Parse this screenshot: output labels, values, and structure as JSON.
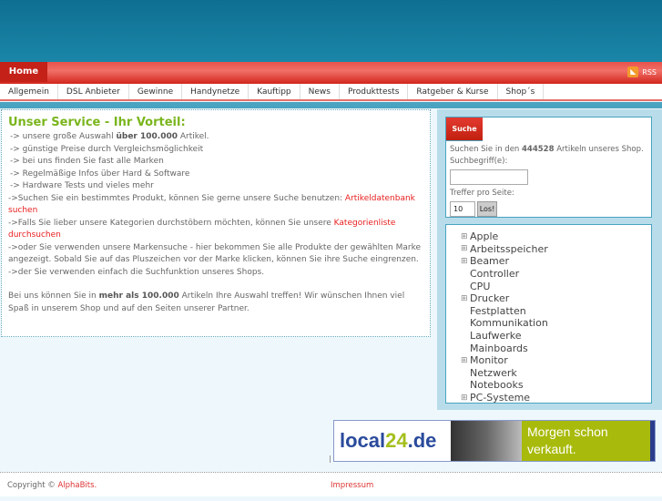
{
  "topbar": {
    "home": "Home",
    "rss": "RSS"
  },
  "nav": [
    "Allgemein",
    "DSL Anbieter",
    "Gewinne",
    "Handynetze",
    "Kauftipp",
    "News",
    "Produkttests",
    "Ratgeber & Kurse",
    "Shop´s"
  ],
  "main": {
    "title": "Unser Service - Ihr Vorteil:",
    "l1a": "-> unsere große Auswahl ",
    "l1b": "über 100.000",
    "l1c": " Artikel.",
    "l2": "-> günstige Preise durch Vergleichsmöglichkeit",
    "l3": "-> bei uns finden Sie fast alle Marken",
    "l4": "-> Regelmäßige Infos über Hard & Software",
    "l5": "-> Hardware Tests und vieles mehr",
    "p1a": "->Suchen Sie ein bestimmtes Produkt, können Sie gerne unsere Suche benutzen: ",
    "p1link": "Artikeldatenbank suchen",
    "p2a": "->Falls Sie lieber unsere Kategorien durchstöbern möchten, können Sie unsere ",
    "p2link": "Kategorienliste durchsuchen",
    "p3": "->oder Sie verwenden unsere Markensuche - hier bekommen Sie alle Produkte der gewählten Marke angezeigt. Sobald Sie auf das Pluszeichen vor der Marke klicken, können Sie ihre Suche eingrenzen.",
    "p4": "->der Sie verwenden einfach die Suchfunktion unseres Shops.",
    "p5a": "Bei uns können Sie in ",
    "p5b": "mehr als 100.000",
    "p5c": " Artikeln Ihre Auswahl treffen! Wir wünschen Ihnen viel Spaß in unserem Shop und auf den Seiten unserer Partner."
  },
  "search": {
    "tab": "Suche",
    "introA": "Suchen Sie in den ",
    "count": "444528",
    "introB": " Artikeln unseres Shop.",
    "term_label": "Suchbegriff(e):",
    "term_value": "",
    "per_label": "Treffer pro Seite:",
    "per_value": "10",
    "go": "Los!"
  },
  "categories": [
    {
      "label": "Apple",
      "expandable": true
    },
    {
      "label": "Arbeitsspeicher",
      "expandable": true
    },
    {
      "label": "Beamer",
      "expandable": true
    },
    {
      "label": "Controller",
      "expandable": false
    },
    {
      "label": "CPU",
      "expandable": false
    },
    {
      "label": "Drucker",
      "expandable": true
    },
    {
      "label": "Festplatten",
      "expandable": false
    },
    {
      "label": "Kommunikation",
      "expandable": false
    },
    {
      "label": "Laufwerke",
      "expandable": false
    },
    {
      "label": "Mainboards",
      "expandable": false
    },
    {
      "label": "Monitor",
      "expandable": true
    },
    {
      "label": "Netzwerk",
      "expandable": false
    },
    {
      "label": "Notebooks",
      "expandable": false
    },
    {
      "label": "PC-Systeme",
      "expandable": true
    }
  ],
  "banner": {
    "logo_a": "local",
    "logo_b": "24",
    "logo_c": ".de",
    "slogan1": "Morgen schon",
    "slogan2": "verkauft."
  },
  "footer": {
    "copy": "Copyright © ",
    "brand": "AlphaBits.",
    "impressum": "Impressum"
  }
}
